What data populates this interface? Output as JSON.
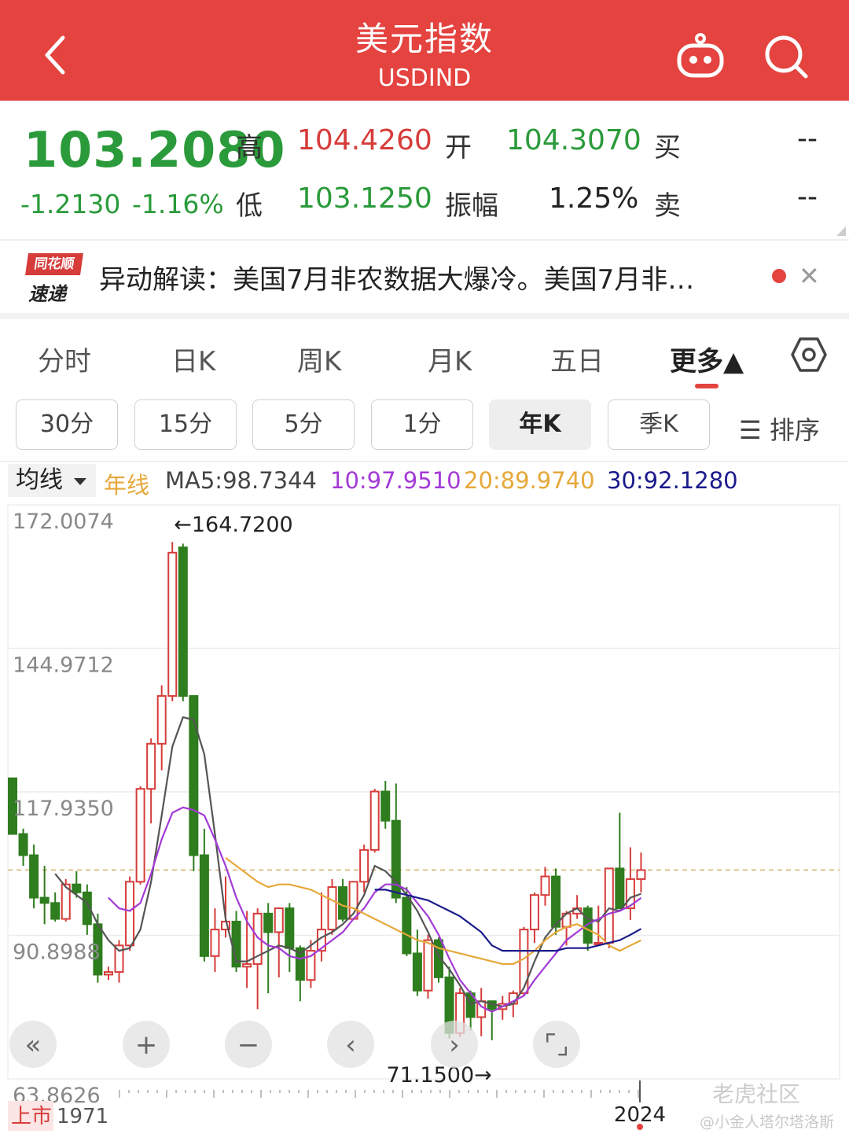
{
  "header": {
    "title": "美元指数",
    "code": "USDIND"
  },
  "quote": {
    "price": "103.2080",
    "change": "-1.2130",
    "change_pct": "-1.16%",
    "high_label": "高",
    "high": "104.4260",
    "low_label": "低",
    "low": "103.1250",
    "open_label": "开",
    "open": "104.3070",
    "amplitude_label": "振幅",
    "amplitude": "1.25%",
    "buy_label": "买",
    "buy": "--",
    "sell_label": "卖",
    "sell": "--"
  },
  "news": {
    "logo_top": "同花顺",
    "logo_bottom": "速递",
    "text": "异动解读：美国7月非农数据大爆冷。美国7月非…"
  },
  "tabs": [
    "分时",
    "日K",
    "周K",
    "月K",
    "五日",
    "更多▲"
  ],
  "period_buttons": [
    "30分",
    "15分",
    "5分",
    "1分",
    "年K",
    "季K"
  ],
  "sort_label": "☰ 排序",
  "ma": {
    "selector": "均线",
    "kind": "年线",
    "ma5": "MA5:98.7344",
    "ma10": "10:97.9510",
    "ma20": "20:89.9740",
    "ma30": "30:92.1280",
    "colors": {
      "ma5": "#555555",
      "ma10": "#a33ad6",
      "ma20": "#e6a83a",
      "ma30": "#1a1a8c"
    }
  },
  "chart_data": {
    "type": "candlestick",
    "y_ticks": [
      "172.0074",
      "144.9712",
      "117.9350",
      "90.8988",
      "63.8626"
    ],
    "ylim": [
      63.8626,
      172.0074
    ],
    "max_label": "←164.7200",
    "min_label": "71.1500→",
    "start_label": "上市",
    "start_year": "1971",
    "end_year": "2024",
    "reference_line": 103.208,
    "up_color": "#d63c3a",
    "down_color": "#2e7d1e",
    "candles": [
      [
        120.5,
        120.5,
        110.0,
        110.0
      ],
      [
        110.0,
        111.0,
        104.0,
        106.0
      ],
      [
        106.0,
        108.0,
        96.0,
        98.0
      ],
      [
        98.0,
        104.0,
        93.0,
        97.0
      ],
      [
        97.0,
        99.0,
        93.5,
        94.0
      ],
      [
        94.0,
        101.5,
        93.5,
        100.5
      ],
      [
        100.5,
        103.0,
        98.0,
        99.0
      ],
      [
        99.0,
        100.5,
        91.0,
        93.0
      ],
      [
        93.0,
        95.0,
        82.0,
        83.5
      ],
      [
        83.5,
        85.0,
        82.5,
        84.0
      ],
      [
        84.0,
        90.0,
        82.0,
        89.0
      ],
      [
        89.0,
        102.0,
        88.0,
        101.0
      ],
      [
        101.0,
        119.0,
        100.5,
        118.5
      ],
      [
        118.5,
        128.0,
        112.0,
        127.0
      ],
      [
        127.0,
        138.0,
        122.0,
        136.0
      ],
      [
        136.0,
        165.0,
        135.0,
        163.0
      ],
      [
        164.0,
        164.7,
        135.0,
        136.0
      ],
      [
        136.0,
        135.8,
        103.0,
        106.0
      ],
      [
        106.0,
        111.0,
        86.0,
        87.0
      ],
      [
        87.0,
        96.0,
        84.0,
        92.0
      ],
      [
        92.0,
        102.0,
        90.5,
        93.5
      ],
      [
        93.5,
        95.5,
        84.0,
        85.0
      ],
      [
        85.0,
        95.5,
        81.0,
        85.5
      ],
      [
        85.5,
        96.0,
        77.0,
        95.0
      ],
      [
        95.0,
        97.0,
        80.0,
        91.5
      ],
      [
        91.5,
        96.0,
        83.0,
        96.0
      ],
      [
        96.0,
        97.0,
        84.0,
        88.5
      ],
      [
        88.5,
        89.0,
        78.5,
        82.5
      ],
      [
        82.5,
        90.0,
        81.0,
        88.0
      ],
      [
        88.0,
        99.0,
        86.0,
        92.0
      ],
      [
        92.0,
        101.5,
        91.0,
        100.0
      ],
      [
        100.0,
        101.5,
        93.5,
        94.0
      ],
      [
        94.0,
        100.5,
        94.0,
        101.0
      ],
      [
        101.0,
        108.0,
        99.0,
        107.0
      ],
      [
        107.0,
        118.5,
        106.5,
        118.0
      ],
      [
        118.0,
        120.0,
        111.0,
        112.5
      ],
      [
        112.5,
        119.5,
        97.0,
        98.0
      ],
      [
        98.0,
        100.0,
        87.0,
        87.5
      ],
      [
        87.5,
        92.0,
        79.5,
        80.5
      ],
      [
        80.5,
        91.0,
        79.0,
        90.0
      ],
      [
        90.0,
        90.5,
        82.0,
        83.0
      ],
      [
        83.0,
        85.0,
        71.5,
        72.5
      ],
      [
        72.5,
        81.0,
        71.8,
        80.0
      ],
      [
        80.0,
        80.5,
        73.0,
        75.5
      ],
      [
        75.5,
        81.0,
        71.9,
        78.5
      ],
      [
        78.5,
        77.0,
        71.15,
        77.0
      ],
      [
        77.0,
        79.5,
        75.0,
        78.0
      ],
      [
        78.0,
        80.5,
        75.5,
        80.0
      ],
      [
        80.0,
        92.5,
        79.5,
        92.0
      ],
      [
        92.0,
        99.0,
        89.5,
        98.5
      ],
      [
        98.5,
        103.8,
        96.5,
        102.0
      ],
      [
        102.0,
        103.5,
        91.0,
        92.5
      ],
      [
        92.5,
        95.5,
        89.0,
        95.0
      ],
      [
        95.0,
        98.5,
        94.0,
        96.0
      ],
      [
        96.0,
        96.5,
        88.0,
        89.5
      ],
      [
        89.5,
        96.5,
        89.0,
        89.5
      ],
      [
        89.5,
        103.2,
        88.5,
        103.5
      ],
      [
        103.5,
        114.0,
        96.5,
        96.0
      ],
      [
        96.0,
        107.5,
        93.8,
        101.5
      ],
      [
        101.5,
        106.5,
        99.0,
        103.2
      ]
    ],
    "ma5": [
      null,
      null,
      null,
      null,
      102.5,
      100.0,
      98.5,
      97.0,
      93.0,
      90.0,
      88.0,
      88.5,
      92.0,
      101.0,
      113.5,
      126.5,
      132.0,
      131.5,
      125.0,
      110.0,
      94.0,
      86.0,
      86.0,
      87.0,
      88.0,
      89.0,
      88.5,
      87.5,
      89.0,
      90.5,
      91.5,
      93.0,
      95.0,
      98.5,
      104.0,
      103.0,
      101.0,
      98.5,
      95.5,
      91.5,
      87.0,
      84.5,
      81.5,
      78.0,
      78.5,
      78.0,
      77.5,
      78.0,
      81.0,
      86.0,
      90.5,
      93.0,
      95.0,
      96.0,
      94.0,
      93.5,
      96.0,
      95.5,
      98.0,
      98.7344
    ],
    "ma10": [
      null,
      null,
      null,
      null,
      null,
      null,
      null,
      null,
      null,
      98.0,
      96.0,
      95.5,
      97.0,
      102.5,
      109.0,
      114.0,
      115.0,
      114.5,
      113.5,
      109.0,
      104.0,
      98.0,
      93.5,
      90.5,
      89.0,
      88.5,
      87.0,
      86.5,
      87.0,
      88.5,
      90.0,
      91.5,
      94.0,
      96.0,
      99.0,
      100.5,
      100.5,
      99.5,
      97.0,
      94.5,
      91.0,
      86.5,
      82.5,
      80.0,
      77.5,
      76.5,
      77.5,
      78.5,
      79.5,
      82.5,
      85.0,
      87.5,
      90.0,
      91.5,
      93.0,
      94.0,
      95.0,
      95.5,
      96.5,
      97.951
    ],
    "ma20": [
      null,
      null,
      null,
      null,
      null,
      null,
      null,
      null,
      null,
      null,
      null,
      null,
      null,
      null,
      null,
      null,
      null,
      null,
      null,
      null,
      105.5,
      104.0,
      102.5,
      101.0,
      100.0,
      100.5,
      100.5,
      100.0,
      99.5,
      98.5,
      97.5,
      96.5,
      96.0,
      95.0,
      94.0,
      93.0,
      92.0,
      91.0,
      90.0,
      89.5,
      88.5,
      88.0,
      87.5,
      87.0,
      86.5,
      86.0,
      85.5,
      85.5,
      86.5,
      88.0,
      90.0,
      91.5,
      92.5,
      93.0,
      92.0,
      91.0,
      89.0,
      88.0,
      89.0,
      89.974
    ],
    "ma30": [
      null,
      null,
      null,
      null,
      null,
      null,
      null,
      null,
      null,
      null,
      null,
      null,
      null,
      null,
      null,
      null,
      null,
      null,
      null,
      null,
      null,
      null,
      null,
      null,
      null,
      null,
      null,
      null,
      null,
      null,
      null,
      null,
      null,
      null,
      99.5,
      99.5,
      99.0,
      98.5,
      98.0,
      97.5,
      96.5,
      95.5,
      94.5,
      93.0,
      91.5,
      89.0,
      88.0,
      88.0,
      88.0,
      88.0,
      88.0,
      88.0,
      88.5,
      88.5,
      88.5,
      89.0,
      89.5,
      90.0,
      91.0,
      92.128
    ]
  },
  "controls": [
    "«",
    "+",
    "−",
    "‹",
    "›",
    "⌜⌟"
  ],
  "watermark": {
    "site": "老虎社区",
    "user": "@小金人塔尔塔洛斯"
  }
}
